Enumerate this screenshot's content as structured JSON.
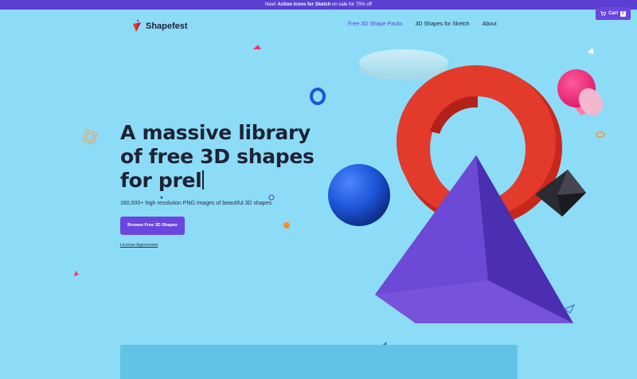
{
  "promo": {
    "prefix": "New! ",
    "highlight": "Action Icons for Sketch",
    "suffix": " on sale for 75% off"
  },
  "header": {
    "logo_text": "Shapefest",
    "nav": [
      {
        "label": "Free 3D Shape Packs",
        "active": true
      },
      {
        "label": "3D Shapes for Sketch",
        "active": false
      },
      {
        "label": "About",
        "active": false
      }
    ],
    "cart": {
      "label": "Cart",
      "count": "0"
    }
  },
  "hero": {
    "title": "A massive library of free 3D shapes for prel",
    "subtitle": "160,000+ high resolution PNG images of beautiful 3D shapes",
    "cta_label": "Browse Free 3D Shapes",
    "license_link": "License Agreement"
  },
  "colors": {
    "background": "#8cdcf7",
    "accent": "#6a46dd",
    "promo_bar": "#5b3fd0",
    "torus": "#e23a2b",
    "pyramid": "#5a3ac4",
    "sphere": "#1c55d6",
    "cylinder": "#ff2a7a"
  }
}
